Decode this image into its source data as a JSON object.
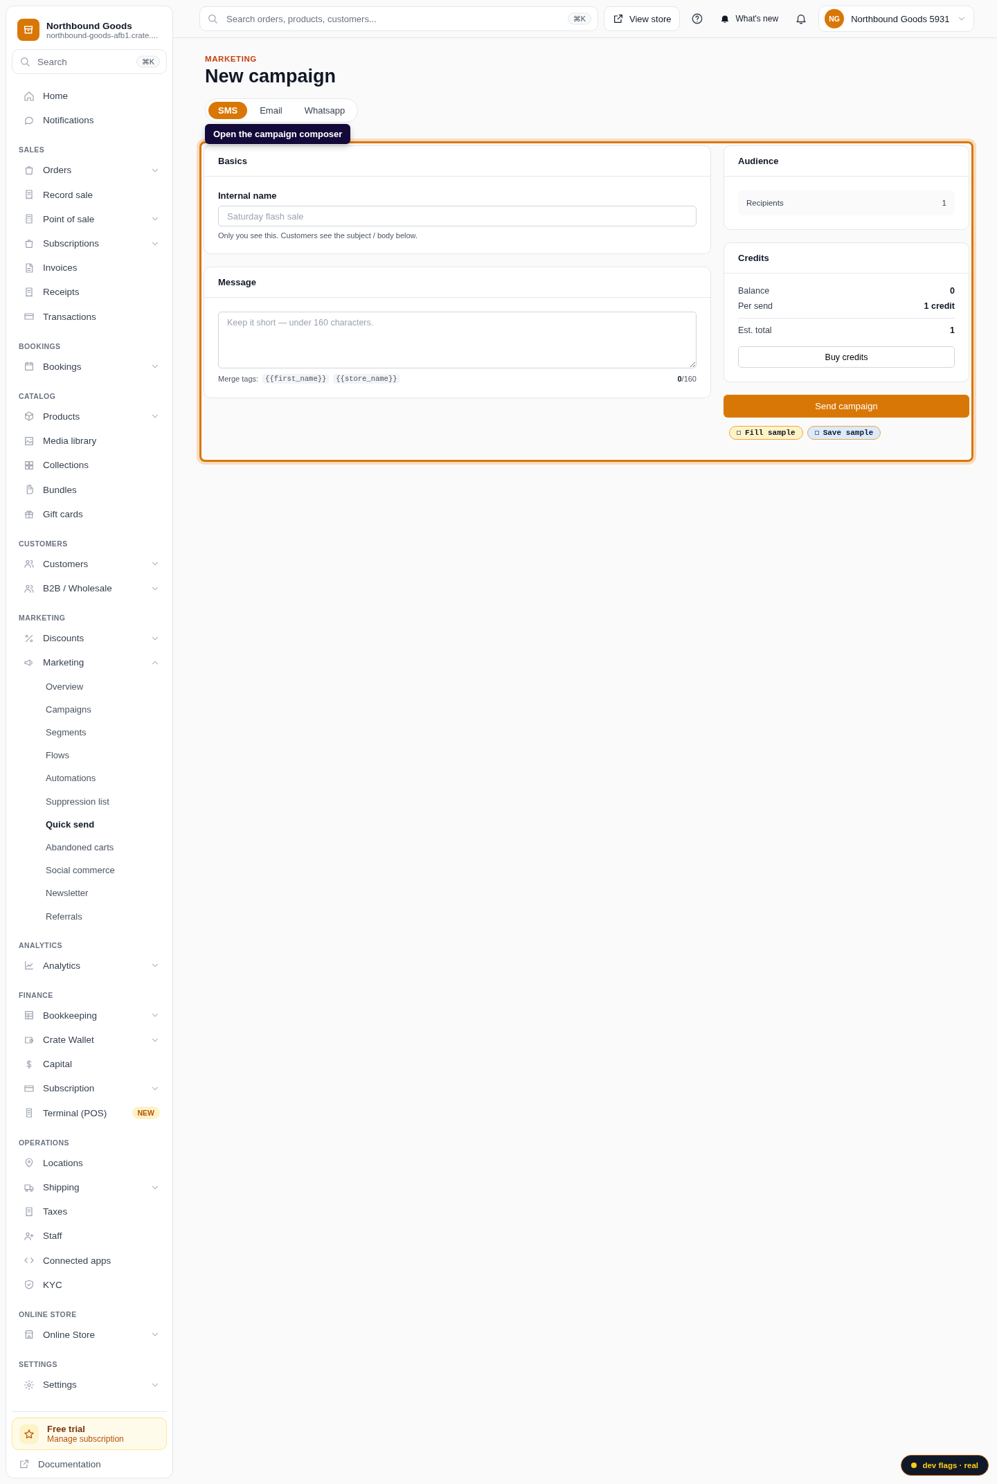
{
  "sidebar": {
    "brand": {
      "name": "Northbound Goods",
      "subtitle": "northbound-goods-afb1.crate...."
    },
    "search": {
      "placeholder": "Search",
      "shortcut": "⌘K"
    },
    "sections": [
      {
        "items": [
          {
            "label": "Home",
            "selected": false,
            "expandable": false
          },
          {
            "label": "Notifications",
            "selected": false,
            "expandable": false
          }
        ]
      },
      {
        "label": "SALES",
        "items": [
          {
            "label": "Orders",
            "selected": false,
            "expandable": true,
            "expanded": false
          },
          {
            "label": "Record sale",
            "selected": false,
            "expandable": false
          },
          {
            "label": "Point of sale",
            "selected": false,
            "expandable": true,
            "expanded": false
          },
          {
            "label": "Subscriptions",
            "selected": false,
            "expandable": true,
            "expanded": false
          },
          {
            "label": "Invoices",
            "selected": false,
            "expandable": false
          },
          {
            "label": "Receipts",
            "selected": false,
            "expandable": false
          },
          {
            "label": "Transactions",
            "selected": false,
            "expandable": false
          }
        ]
      },
      {
        "label": "BOOKINGS",
        "items": [
          {
            "label": "Bookings",
            "selected": false,
            "expandable": true,
            "expanded": false
          }
        ]
      },
      {
        "label": "CATALOG",
        "items": [
          {
            "label": "Products",
            "selected": false,
            "expandable": true,
            "expanded": false
          },
          {
            "label": "Media library",
            "selected": false,
            "expandable": false
          },
          {
            "label": "Collections",
            "selected": false,
            "expandable": false
          },
          {
            "label": "Bundles",
            "selected": false,
            "expandable": false
          },
          {
            "label": "Gift cards",
            "selected": false,
            "expandable": false
          }
        ]
      },
      {
        "label": "CUSTOMERS",
        "items": [
          {
            "label": "Customers",
            "selected": false,
            "expandable": true,
            "expanded": false
          },
          {
            "label": "B2B / Wholesale",
            "selected": false,
            "expandable": true,
            "expanded": false
          }
        ]
      },
      {
        "label": "MARKETING",
        "items": [
          {
            "label": "Discounts",
            "selected": false,
            "expandable": true,
            "expanded": false
          },
          {
            "label": "Marketing",
            "selected": false,
            "expandable": true,
            "expanded": true,
            "children": [
              {
                "label": "Overview",
                "selected": false
              },
              {
                "label": "Campaigns",
                "selected": false
              },
              {
                "label": "Segments",
                "selected": false
              },
              {
                "label": "Flows",
                "selected": false
              },
              {
                "label": "Automations",
                "selected": false
              },
              {
                "label": "Suppression list",
                "selected": false
              },
              {
                "label": "Quick send",
                "selected": true
              },
              {
                "label": "Abandoned carts",
                "selected": false
              },
              {
                "label": "Social commerce",
                "selected": false
              },
              {
                "label": "Newsletter",
                "selected": false
              },
              {
                "label": "Referrals",
                "selected": false
              }
            ]
          }
        ]
      },
      {
        "label": "ANALYTICS",
        "items": [
          {
            "label": "Analytics",
            "selected": false,
            "expandable": true,
            "expanded": false
          }
        ]
      },
      {
        "label": "FINANCE",
        "items": [
          {
            "label": "Bookkeeping",
            "selected": false,
            "expandable": true,
            "expanded": false
          },
          {
            "label": "Crate Wallet",
            "selected": false,
            "expandable": true,
            "expanded": false
          },
          {
            "label": "Capital",
            "selected": false,
            "expandable": false
          },
          {
            "label": "Subscription",
            "selected": false,
            "expandable": true,
            "expanded": false
          },
          {
            "label": "Terminal (POS)",
            "selected": false,
            "expandable": false,
            "badge": "NEW"
          }
        ]
      },
      {
        "label": "OPERATIONS",
        "items": [
          {
            "label": "Locations",
            "selected": false,
            "expandable": false
          },
          {
            "label": "Shipping",
            "selected": false,
            "expandable": true,
            "expanded": false
          },
          {
            "label": "Taxes",
            "selected": false,
            "expandable": false
          },
          {
            "label": "Staff",
            "selected": false,
            "expandable": false
          },
          {
            "label": "Connected apps",
            "selected": false,
            "expandable": false
          },
          {
            "label": "KYC",
            "selected": false,
            "expandable": false
          }
        ]
      },
      {
        "label": "ONLINE STORE",
        "items": [
          {
            "label": "Online Store",
            "selected": false,
            "expandable": true,
            "expanded": false
          }
        ]
      },
      {
        "label": "SETTINGS",
        "items": [
          {
            "label": "Settings",
            "selected": false,
            "expandable": true,
            "expanded": false
          }
        ]
      }
    ],
    "trial": {
      "title": "Free trial",
      "link": "Manage subscription"
    },
    "footer_link": "Documentation"
  },
  "topbar": {
    "search": {
      "placeholder": "Search orders, products, customers...",
      "shortcut": "⌘K"
    },
    "view_store": "View store",
    "whats_new": "What's new",
    "account": {
      "initials": "NG",
      "name": "Northbound Goods 5931"
    }
  },
  "page": {
    "eyebrow": "MARKETING",
    "title": "New campaign",
    "tabs": [
      {
        "label": "SMS",
        "selected": true
      },
      {
        "label": "Email",
        "selected": false
      },
      {
        "label": "Whatsapp",
        "selected": false
      }
    ],
    "tooltip": "Open the campaign composer"
  },
  "basics": {
    "title": "Basics",
    "field_label": "Internal name",
    "placeholder": "Saturday flash sale",
    "hint": "Only you see this. Customers see the subject / body below."
  },
  "message": {
    "title": "Message",
    "placeholder": "Keep it short — under 160 characters.",
    "merge_label": "Merge tags:",
    "merge_tags": [
      "{{first_name}}",
      "{{store_name}}"
    ],
    "count": "**0**/160"
  },
  "audience": {
    "title": "Audience",
    "rows": [
      {
        "label": "Recipients",
        "value": "1"
      }
    ]
  },
  "credits": {
    "title": "Credits",
    "rows": [
      {
        "label": "Balance",
        "value": "0"
      },
      {
        "label": "Per send",
        "value": "1 credit"
      }
    ],
    "total": {
      "label": "Est. total",
      "value": "1"
    },
    "button": "Buy credits"
  },
  "send_button": "Send campaign",
  "sample_buttons": [
    {
      "label": "Fill sample",
      "color": "#fef3c7"
    },
    {
      "label": "Save sample",
      "color": "#dbeafe"
    }
  ],
  "dev_flag": "dev flags · real"
}
